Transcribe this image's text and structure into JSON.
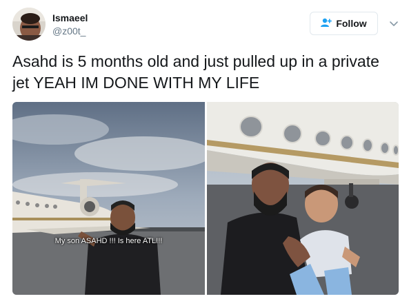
{
  "user": {
    "name": "Ismaeel",
    "handle": "@z00t_"
  },
  "follow_button": {
    "label": "Follow",
    "icon": "add-user-icon"
  },
  "menu_icon": "chevron-down-icon",
  "tweet": {
    "text": "Asahd is 5 months old and just pulled up in a private jet YEAH IM DONE WITH MY LIFE"
  },
  "media": {
    "left_caption": "My son ASAHD !!! Is here ATL!!!"
  },
  "colors": {
    "accent": "#1da1f2",
    "text": "#14171a",
    "secondary_text": "#657786",
    "border": "#e1e8ed"
  }
}
